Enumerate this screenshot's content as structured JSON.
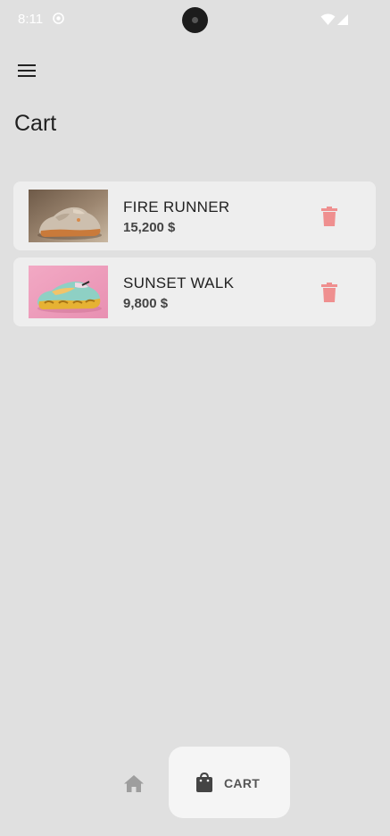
{
  "status_bar": {
    "time": "8:11"
  },
  "header": {
    "title": "Cart",
    "menu_icon": "hamburger-menu-icon"
  },
  "cart": {
    "items": [
      {
        "name": "FIRE RUNNER",
        "price": "15,200 $",
        "thumbnail": "beige-orange sneaker photo"
      },
      {
        "name": "SUNSET WALK",
        "price": "9,800 $",
        "thumbnail": "pastel chunky sneaker on pink photo"
      }
    ],
    "delete_icon": "trash-icon",
    "delete_color": "#ef8f8f"
  },
  "bottom_nav": {
    "home_icon": "home-icon",
    "cart_icon": "shopping-bag-icon",
    "cart_label": "CART",
    "active": "CART"
  },
  "colors": {
    "background": "#e0e0e0",
    "card": "#eeeeee",
    "active_nav": "#f5f5f5"
  }
}
